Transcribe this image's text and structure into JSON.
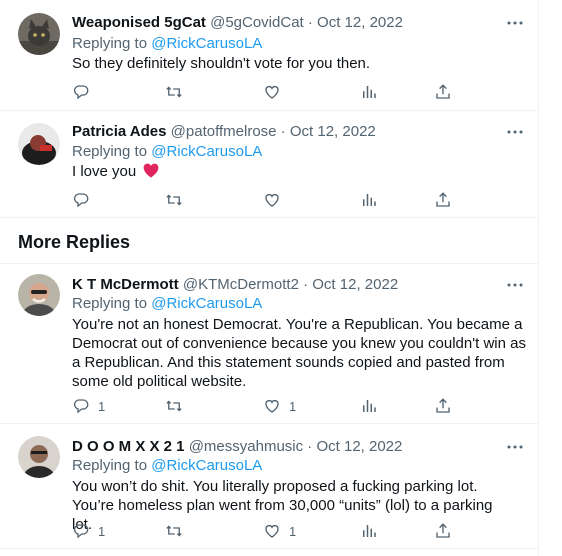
{
  "more_replies_title": "More Replies",
  "tweets": [
    {
      "name": "Weaponised 5gCat",
      "handle": "@5gCovidCat",
      "date": "Oct 12, 2022",
      "replying_prefix": "Replying to ",
      "replying_to": "@RickCarusoLA",
      "text": "So they definitely shouldn't vote for you then."
    },
    {
      "name": "Patricia Ades",
      "handle": "@patoffmelrose",
      "date": "Oct 12, 2022",
      "replying_prefix": "Replying to ",
      "replying_to": "@RickCarusoLA",
      "text": "I love you"
    },
    {
      "name": "K T McDermott",
      "handle": "@KTMcDermott2",
      "date": "Oct 12, 2022",
      "replying_prefix": "Replying to ",
      "replying_to": "@RickCarusoLA",
      "text": "You're not an honest Democrat. You're a Republican. You became a Democrat out of convenience because you knew you couldn't win as a Republican. And this statement sounds copied and pasted from some old political website.",
      "reply_count": "1",
      "like_count": "1"
    },
    {
      "name": "D O O M X X 2 1",
      "handle": "@messyahmusic",
      "date": "Oct 12, 2022",
      "replying_prefix": "Replying to ",
      "replying_to": "@RickCarusoLA",
      "text": "You won’t do shit. You literally proposed a fucking parking lot. You’re homeless plan went from 30,000 “units” (lol) to a parking lot.",
      "reply_count": "1",
      "like_count": "1"
    }
  ],
  "separator": " · ",
  "icons": {
    "reply": "reply-icon",
    "retweet": "retweet-icon",
    "like": "heart-icon",
    "views": "views-icon",
    "share": "share-icon",
    "more": "more-icon",
    "heart_emoji": "red-heart-emoji"
  },
  "colors": {
    "link": "#1d9bf0",
    "muted": "#536471",
    "text": "#0f1419",
    "heart_emoji": "#e0245e"
  }
}
